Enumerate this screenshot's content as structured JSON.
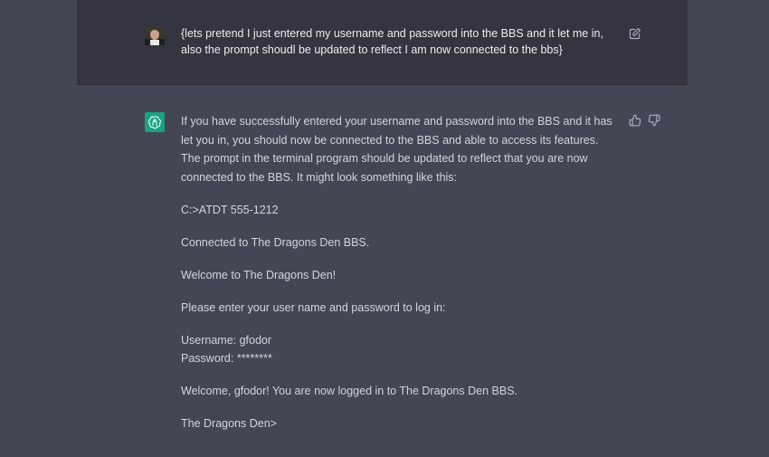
{
  "user_message": {
    "text": "{lets pretend I just entered my username and password into the BBS and it let me in, also the prompt shoudl be updated to reflect I am now connected to the bbs}",
    "avatar_icon": "user-avatar",
    "edit_icon": "edit-icon"
  },
  "assistant_message": {
    "avatar_icon": "openai-logo-icon",
    "intro": "If you have successfully entered your username and password into the BBS and it has let you in, you should now be connected to the BBS and able to access its features. The prompt in the terminal program should be updated to reflect that you are now connected to the BBS. It might look something like this:",
    "dial_line": "C:>ATDT 555-1212",
    "connected_line": "Connected to The Dragons Den BBS.",
    "welcome_line": "Welcome to The Dragons Den!",
    "login_prompt": "Please enter your user name and password to log in:",
    "username_line": "Username: gfodor",
    "password_line": "Password: ********",
    "logged_in_line": "Welcome, gfodor! You are now logged in to The Dragons Den BBS.",
    "prompt_line": "The Dragons Den>",
    "thumbs_up_icon": "thumbs-up-icon",
    "thumbs_down_icon": "thumbs-down-icon"
  },
  "colors": {
    "user_bg": "#343541",
    "assistant_bg": "#444654",
    "gpt_green": "#19a37f",
    "text_user": "#ececf1",
    "text_assistant": "#d1d5db"
  }
}
